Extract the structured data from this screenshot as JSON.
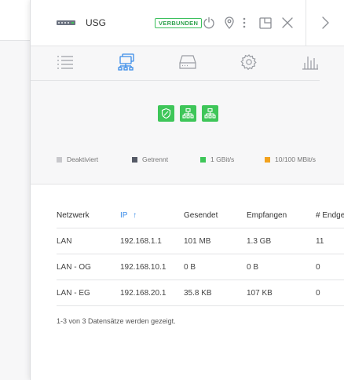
{
  "device": {
    "name": "USG",
    "status": "VERBUNDEN"
  },
  "header_icons": [
    "power-icon",
    "location-pin-icon",
    "more-vert-icon",
    "window-icon",
    "close-icon",
    "chevron-right-icon"
  ],
  "tabs": [
    {
      "name": "list-icon",
      "active": false
    },
    {
      "name": "network-topology-icon",
      "active": true
    },
    {
      "name": "drive-icon",
      "active": false
    },
    {
      "name": "gear-icon",
      "active": false
    },
    {
      "name": "stats-bars-icon",
      "active": false
    }
  ],
  "ports": [
    "shield-port-icon",
    "network-port-icon",
    "network-port-icon"
  ],
  "legend": [
    {
      "label": "Deaktiviert",
      "color": "#c8c8cc"
    },
    {
      "label": "Getrennt",
      "color": "#555a66"
    },
    {
      "label": "1 GBit/s",
      "color": "#3ec659"
    },
    {
      "label": "10/100 MBit/s",
      "color": "#f2a21e"
    }
  ],
  "colors": {
    "accent": "#3b8ce8",
    "green": "#3ec659"
  },
  "table": {
    "headers": [
      "Netzwerk",
      "IP",
      "Gesendet",
      "Empfangen",
      "# Endge"
    ],
    "sort_column": "IP",
    "sort_arrow": "↑",
    "rows": [
      [
        "LAN",
        "192.168.1.1",
        "101 MB",
        "1.3 GB",
        "11"
      ],
      [
        "LAN - OG",
        "192.168.10.1",
        "0 B",
        "0 B",
        "0"
      ],
      [
        "LAN - EG",
        "192.168.20.1",
        "35.8 KB",
        "107 KB",
        "0"
      ]
    ]
  },
  "footer_text": "1-3 von 3 Datensätze werden gezeigt."
}
